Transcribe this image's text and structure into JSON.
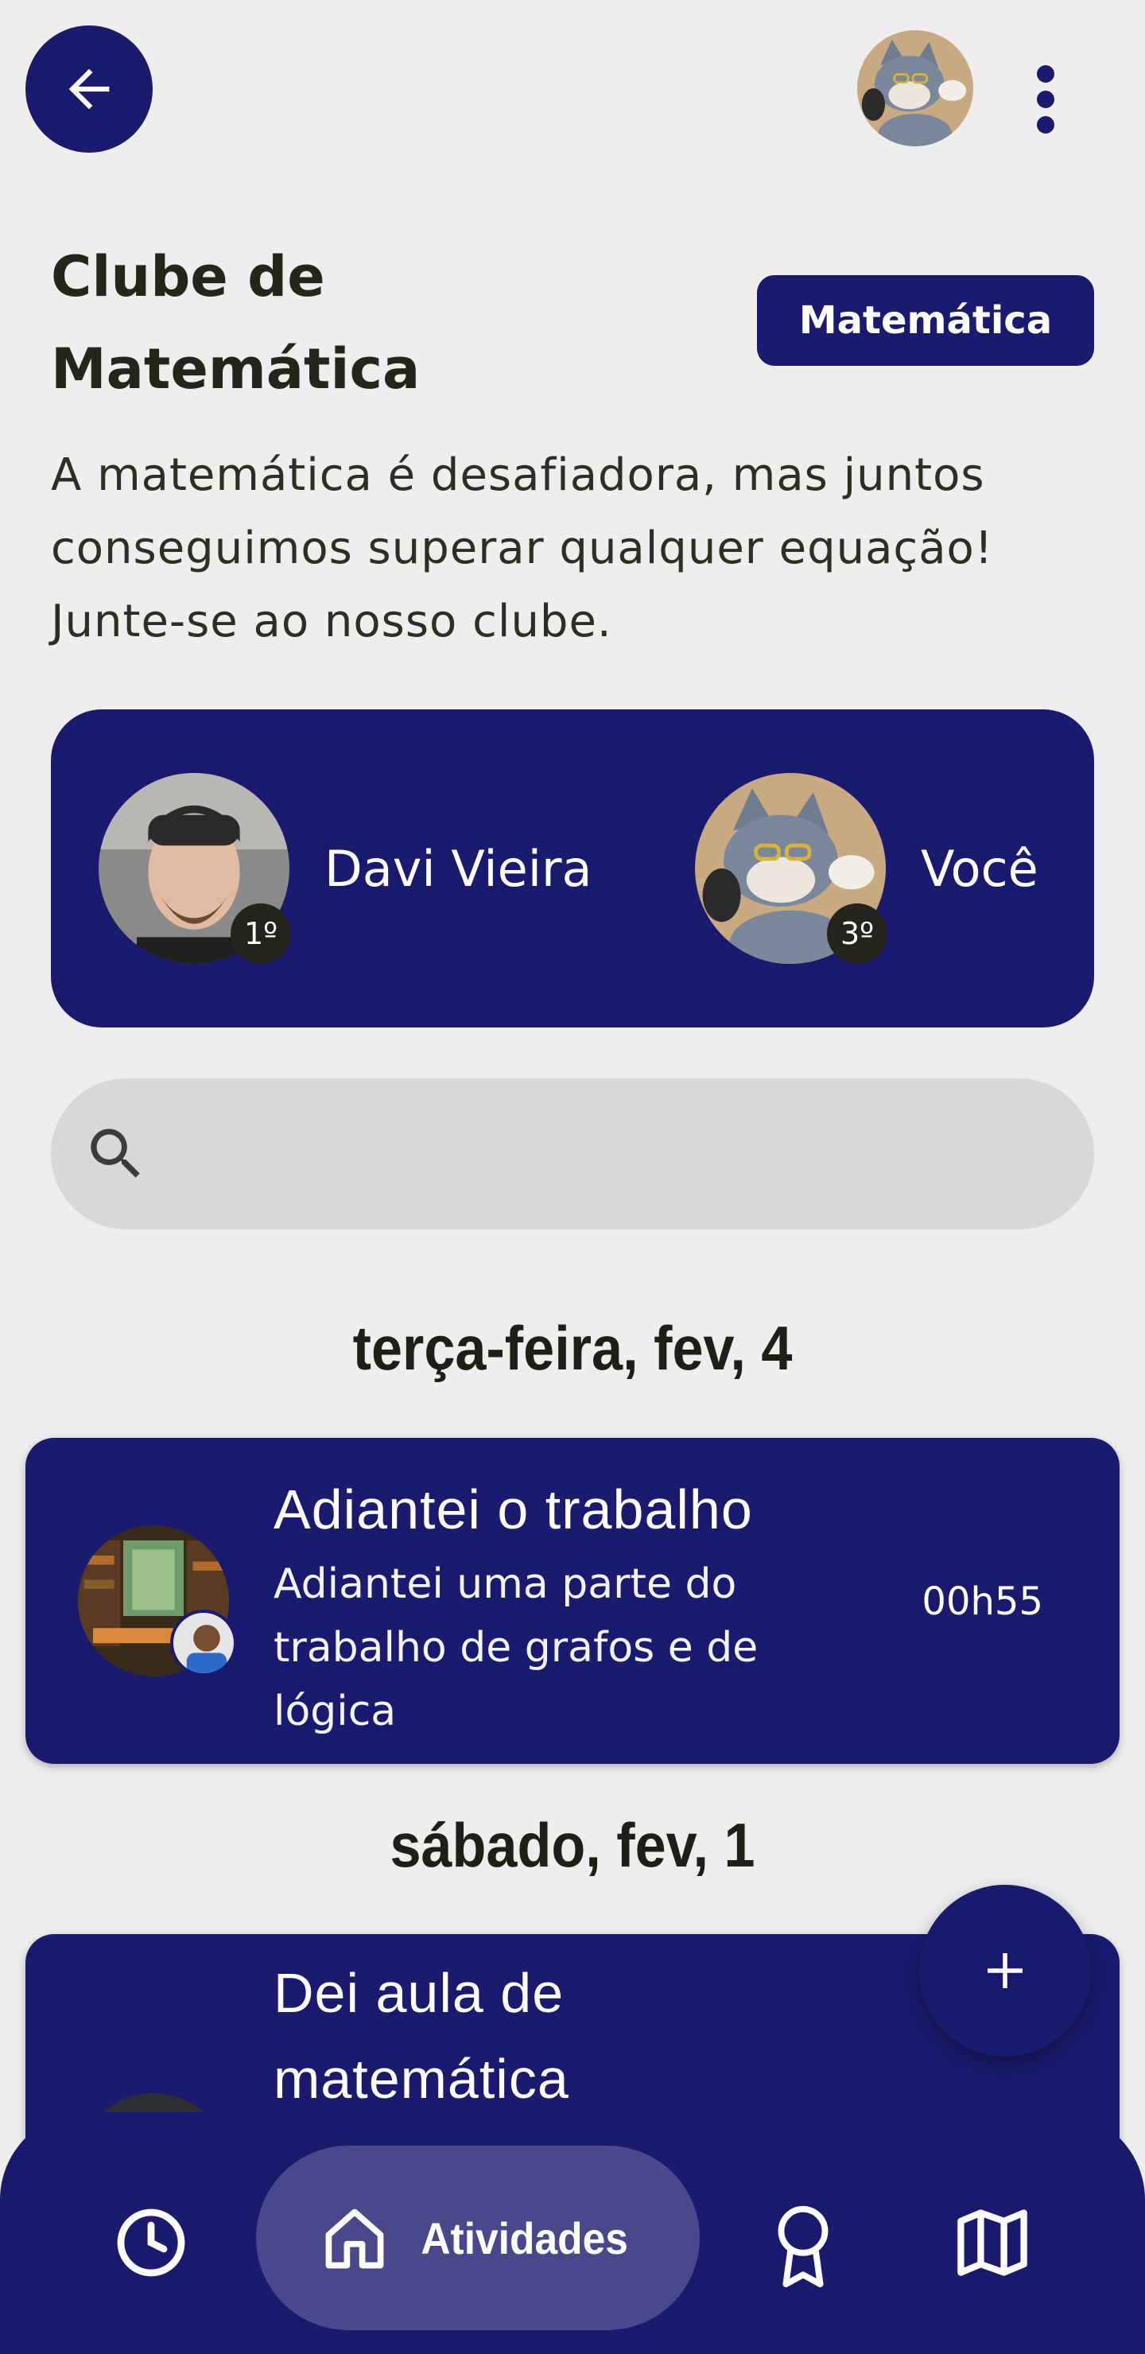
{
  "header": {
    "back_icon": "arrow-left-icon",
    "menu_icon": "more-vertical-icon"
  },
  "club": {
    "title": "Clube de Matemática",
    "subject": "Matemática",
    "description": "A matemática é desafiadora, mas juntos conseguimos superar qualquer equação! Junte-se ao nosso clube."
  },
  "ranking": {
    "first": {
      "name": "Davi Vieira",
      "position": "1º"
    },
    "me": {
      "name": "Você",
      "position": "3º"
    }
  },
  "search": {
    "placeholder": "",
    "value": "",
    "icon": "search-icon"
  },
  "feed": {
    "groups": [
      {
        "date": "terça-feira, fev, 4",
        "activities": [
          {
            "title": "Adiantei o trabalho",
            "description": "Adiantei uma parte do trabalho de grafos e de lógica",
            "duration": "00h55"
          }
        ]
      },
      {
        "date": "sábado, fev, 1",
        "activities": [
          {
            "title": "Dei aula de matemática",
            "description": "",
            "duration": ""
          }
        ]
      }
    ]
  },
  "fab": {
    "icon": "plus-icon"
  },
  "nav": {
    "items": [
      {
        "id": "history",
        "icon": "clock-icon",
        "label": ""
      },
      {
        "id": "activities",
        "icon": "home-icon",
        "label": "Atividades",
        "active": true
      },
      {
        "id": "awards",
        "icon": "award-icon",
        "label": ""
      },
      {
        "id": "map",
        "icon": "map-icon",
        "label": ""
      }
    ]
  },
  "colors": {
    "primary": "#1a1a6e",
    "background": "#efeded",
    "nav_active": "#48488a",
    "search_bg": "#d8d8d8",
    "text_dark": "#252519"
  }
}
